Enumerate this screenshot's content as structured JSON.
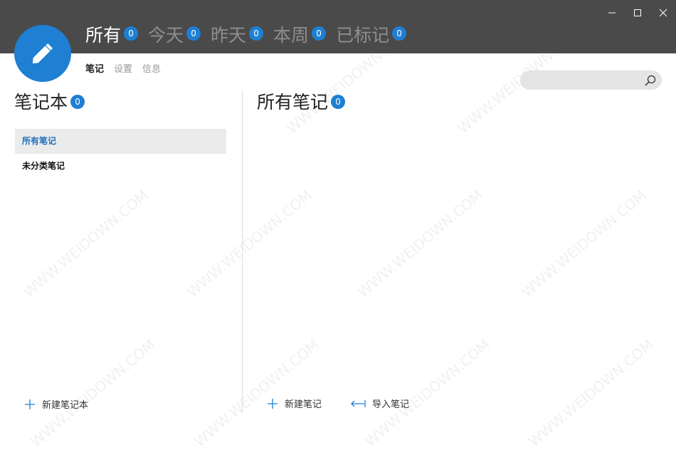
{
  "filters": [
    {
      "label": "所有",
      "count": "0"
    },
    {
      "label": "今天",
      "count": "0"
    },
    {
      "label": "昨天",
      "count": "0"
    },
    {
      "label": "本周",
      "count": "0"
    },
    {
      "label": "已标记",
      "count": "0"
    }
  ],
  "subnav": {
    "notes": "笔记",
    "settings": "设置",
    "info": "信息"
  },
  "search": {
    "value": ""
  },
  "notebooks": {
    "title": "笔记本",
    "count": "0",
    "items": [
      "所有笔记",
      "未分类笔记"
    ],
    "new_label": "新建笔记本"
  },
  "notes": {
    "title": "所有笔记",
    "count": "0",
    "new_label": "新建笔记",
    "import_label": "导入笔记"
  },
  "watermark": "WWW.WEIDOWN.COM",
  "colors": {
    "accent": "#1e7fd3",
    "topbar": "#4a4a4a",
    "selected_bg": "#ebebeb"
  },
  "icons": [
    "minimize-icon",
    "maximize-icon",
    "close-icon",
    "pencil-icon",
    "search-icon",
    "plus-icon",
    "import-icon"
  ]
}
